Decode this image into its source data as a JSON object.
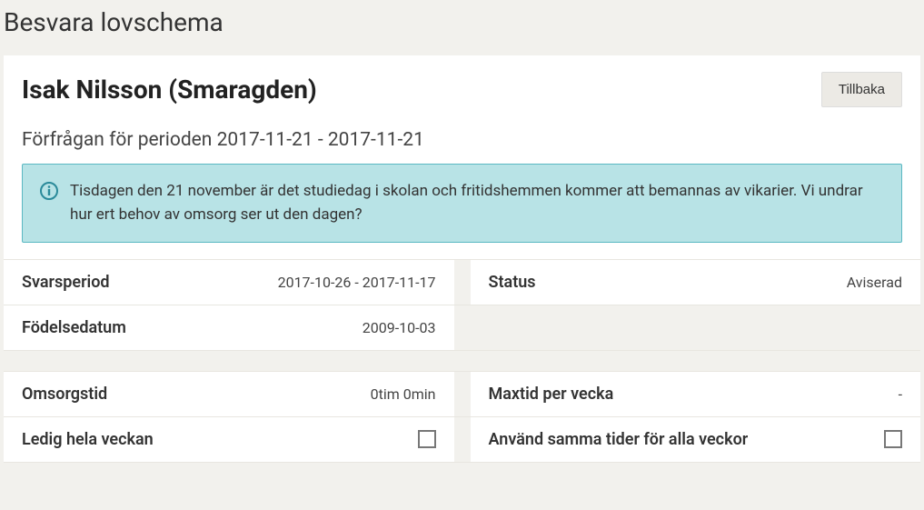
{
  "page": {
    "title": "Besvara lovschema"
  },
  "header": {
    "student_name": "Isak Nilsson (Smaragden)",
    "back_label": "Tillbaka"
  },
  "period": {
    "title": "Förfrågan för perioden 2017-11-21 - 2017-11-21"
  },
  "info": {
    "text": "Tisdagen den 21 november är det studiedag i skolan och fritidshemmen kommer att bemannas av vikarier. Vi undrar hur ert behov av omsorg ser ut den dagen?"
  },
  "details": {
    "svarsperiod_label": "Svarsperiod",
    "svarsperiod_value": "2017-10-26 - 2017-11-17",
    "status_label": "Status",
    "status_value": "Aviserad",
    "fodelsedatum_label": "Födelsedatum",
    "fodelsedatum_value": "2009-10-03"
  },
  "care": {
    "omsorgstid_label": "Omsorgstid",
    "omsorgstid_value": "0tim 0min",
    "maxtid_label": "Maxtid per vecka",
    "maxtid_value": "-",
    "ledig_label": "Ledig hela veckan",
    "samma_tider_label": "Använd samma tider för alla veckor"
  }
}
